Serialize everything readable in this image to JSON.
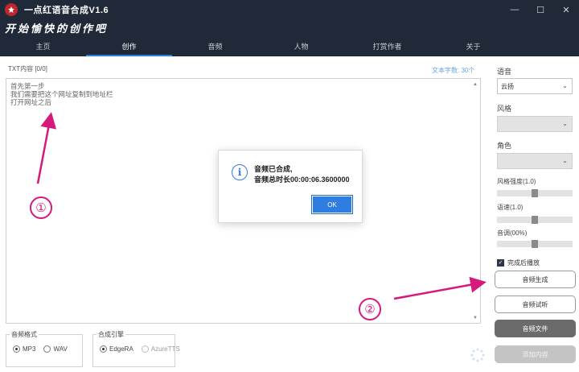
{
  "window": {
    "title": "一点红语音合成V1.6",
    "minimize_glyph": "—",
    "maximize_glyph": "☐",
    "close_glyph": "✕"
  },
  "banner": {
    "slogan": "开始愉快的创作吧"
  },
  "nav": {
    "items": [
      {
        "label": "主页"
      },
      {
        "label": "创作"
      },
      {
        "label": "音频"
      },
      {
        "label": "人物"
      },
      {
        "label": "打赏作者"
      },
      {
        "label": "关于"
      }
    ],
    "active_index": 1
  },
  "editor": {
    "label": "TXT内容 [0/0]",
    "word_count": "文本字数: 30个",
    "lines": [
      "首先第一步",
      "我们需要把这个网址复制到地址栏",
      "打开网址之后"
    ]
  },
  "right_panel": {
    "voice_label": "语音",
    "voice_value": "云扬",
    "style_label": "风格",
    "role_label": "角色",
    "style_strength_label": "风格强度(1.0)",
    "style_strength": 0.5,
    "speed_label": "语速(1.0)",
    "speed": 0.5,
    "pitch_label": "音调(00%)",
    "pitch": 0.5,
    "autoplay_label": "完成后播放",
    "autoplay_checked": true,
    "buttons": {
      "generate": "音频生成",
      "preview": "音频试听",
      "file": "音频文件",
      "add": "添加内容"
    }
  },
  "audio_format": {
    "title": "音频格式",
    "options": [
      "MP3",
      "WAV"
    ],
    "selected": "MP3"
  },
  "engine": {
    "title": "合成引擎",
    "options": [
      "EdgeRA",
      "AzureTTS"
    ],
    "selected": "EdgeRA"
  },
  "dialog": {
    "line1": "音频已合成,",
    "line2": "音频总时长00:00:06.3600000",
    "ok": "OK"
  },
  "annotations": {
    "one": "①",
    "two": "②",
    "color": "#d61a7c"
  }
}
